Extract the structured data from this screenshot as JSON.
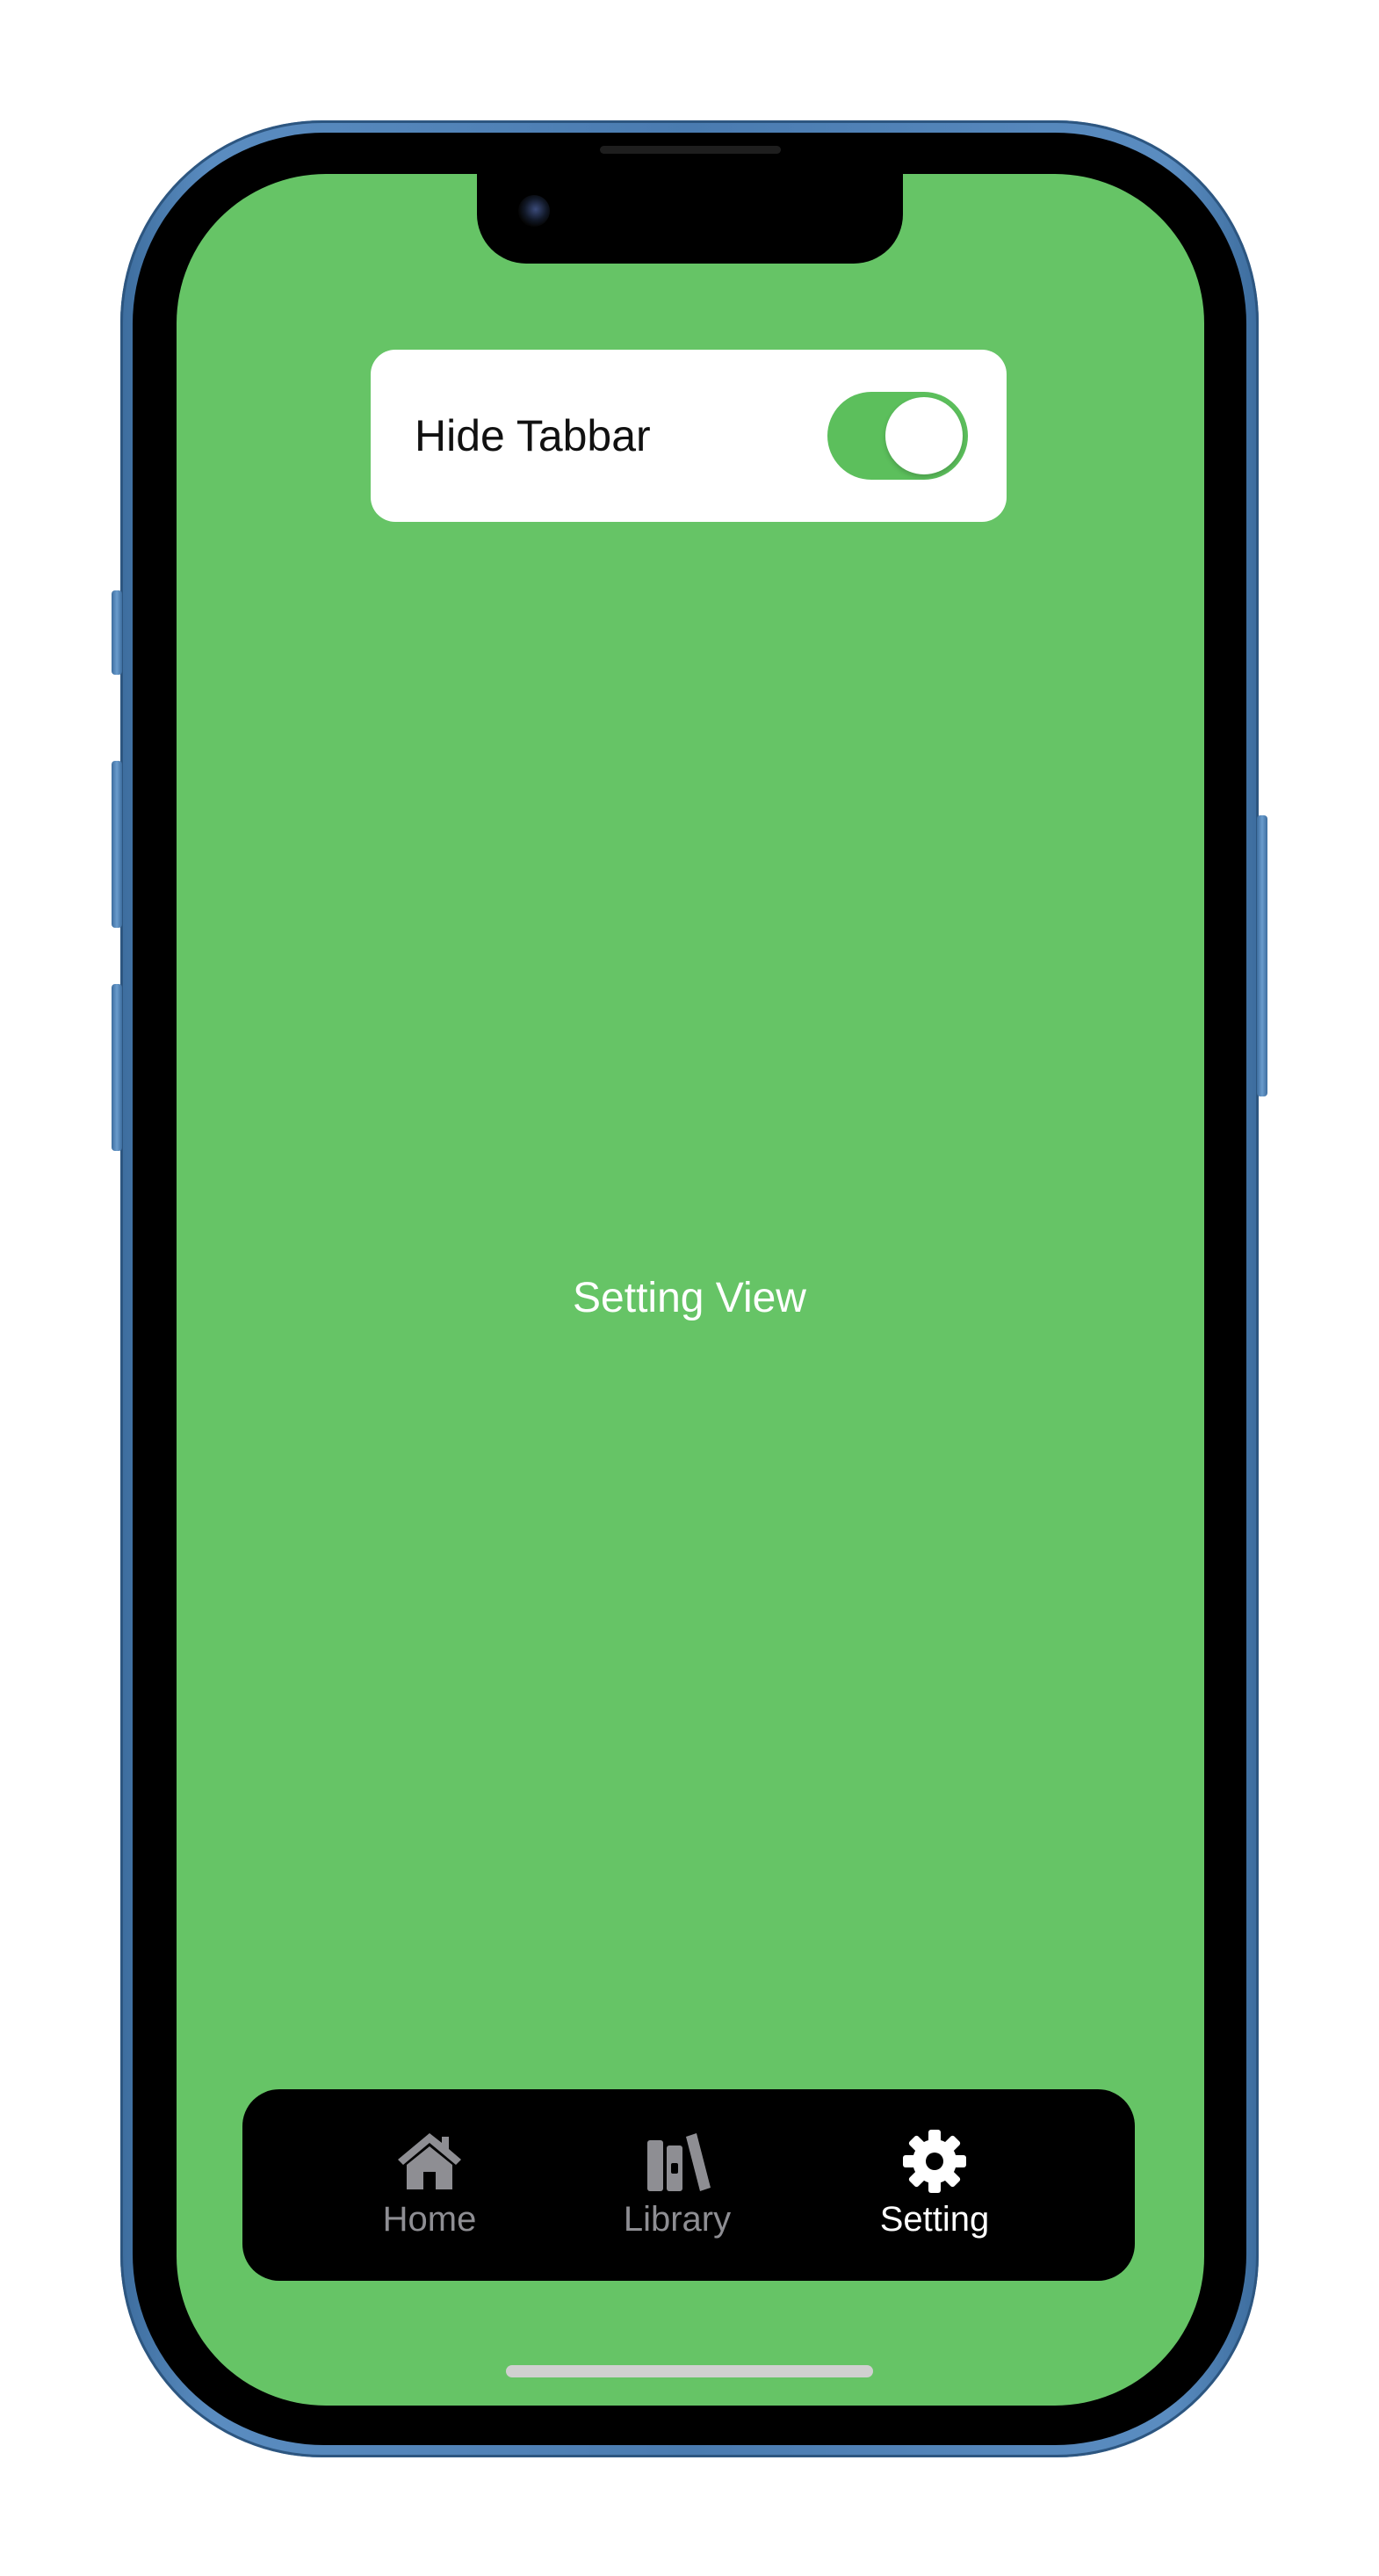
{
  "settings_card": {
    "label": "Hide Tabbar",
    "toggle_on": true
  },
  "main": {
    "title": "Setting View"
  },
  "tabbar": {
    "items": [
      {
        "label": "Home",
        "icon": "house-icon",
        "selected": false
      },
      {
        "label": "Library",
        "icon": "books-icon",
        "selected": false
      },
      {
        "label": "Setting",
        "icon": "gear-icon",
        "selected": true
      }
    ]
  },
  "colors": {
    "background": "#66c466",
    "toggle_on": "#5cbf5c",
    "tabbar_background": "#000000",
    "tab_inactive": "#8e8e93",
    "tab_active": "#ffffff",
    "phone_frame": "#4a7bb0"
  }
}
